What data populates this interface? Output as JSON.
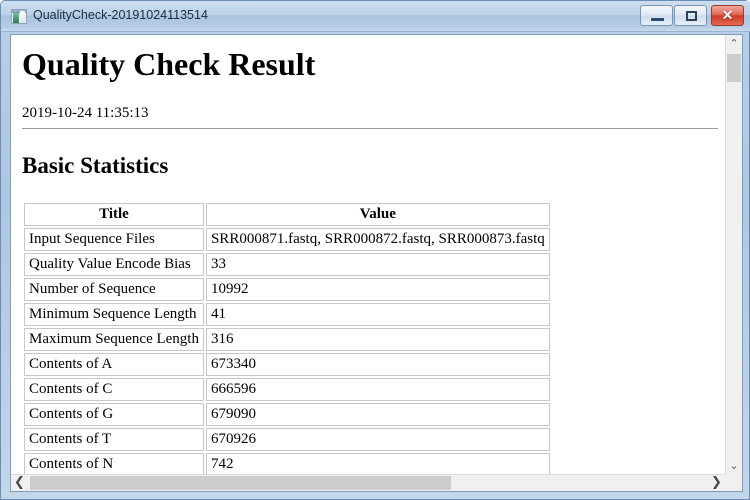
{
  "window": {
    "title": "QualityCheck-20191024113514",
    "icon": "app-window-icon",
    "controls": {
      "minimize_label": "–",
      "maximize_label": "□",
      "close_label": "✕"
    }
  },
  "document": {
    "title": "Quality Check Result",
    "timestamp": "2019-10-24 11:35:13",
    "section_title": "Basic Statistics",
    "table": {
      "headers": [
        "Title",
        "Value"
      ],
      "rows": [
        [
          "Input Sequence Files",
          "SRR000871.fastq, SRR000872.fastq, SRR000873.fastq"
        ],
        [
          "Quality Value Encode Bias",
          "33"
        ],
        [
          "Number of Sequence",
          "10992"
        ],
        [
          "Minimum Sequence Length",
          "41"
        ],
        [
          "Maximum Sequence Length",
          "316"
        ],
        [
          "Contents of A",
          "673340"
        ],
        [
          "Contents of C",
          "666596"
        ],
        [
          "Contents of G",
          "679090"
        ],
        [
          "Contents of T",
          "670926"
        ],
        [
          "Contents of N",
          "742"
        ]
      ]
    }
  },
  "scrollbars": {
    "vertical": {
      "up_arrow": "⌃",
      "down_arrow": "⌄"
    },
    "horizontal": {
      "left_arrow": "❮",
      "right_arrow": "❯"
    }
  },
  "colors": {
    "titlebar_accent": "#b6cce5",
    "close_button": "#cf3b26",
    "window_border": "#6b8db5",
    "scrollbar_thumb": "#cdcdcd"
  }
}
